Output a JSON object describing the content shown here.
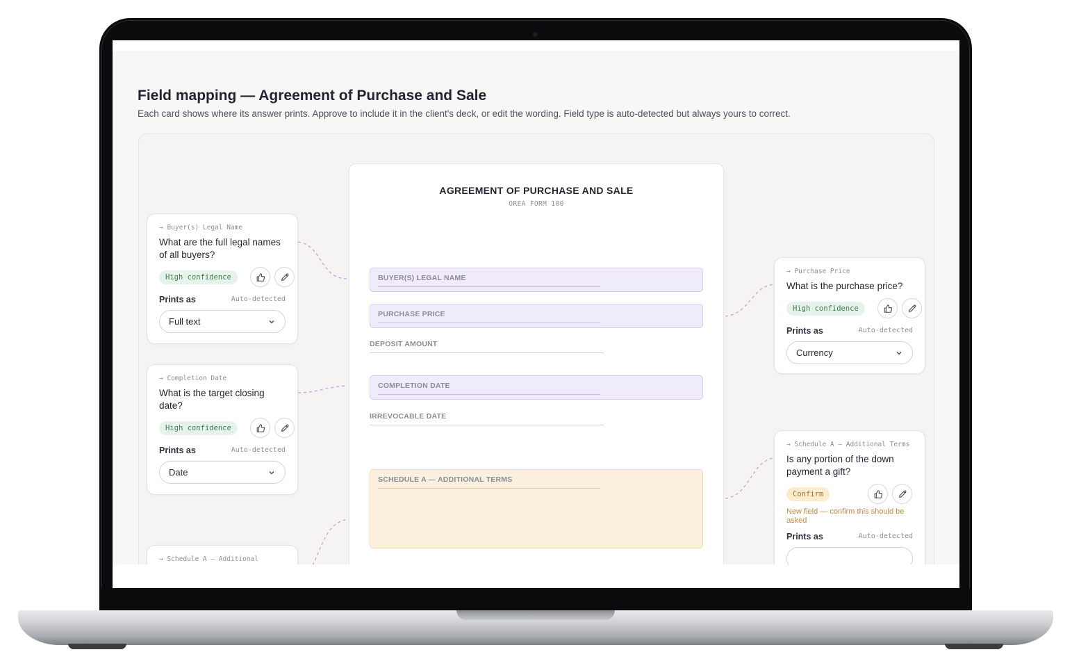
{
  "page": {
    "title": "Field mapping — Agreement of Purchase and Sale",
    "subtitle": "Each card shows where its answer prints. Approve to include it in the client's deck, or edit the wording. Field type is auto-detected but always yours to correct."
  },
  "document": {
    "title": "AGREEMENT OF PURCHASE AND SALE",
    "form": "OREA FORM 100",
    "fields": {
      "buyer_name": "BUYER(S) LEGAL NAME",
      "purchase_price": "PURCHASE PRICE",
      "deposit_amount": "DEPOSIT AMOUNT",
      "completion_date": "COMPLETION DATE",
      "irrevocable_date": "IRREVOCABLE DATE",
      "schedule_a": "SCHEDULE A — ADDITIONAL TERMS"
    }
  },
  "cards": {
    "buyer": {
      "tag": "→ Buyer(s) Legal Name",
      "question": "What are the full legal names of all buyers?",
      "badge": "High confidence",
      "prints_label": "Prints as",
      "auto": "Auto-detected",
      "type": "Full text"
    },
    "completion": {
      "tag": "→ Completion Date",
      "question": "What is the target closing date?",
      "badge": "High confidence",
      "prints_label": "Prints as",
      "auto": "Auto-detected",
      "type": "Date"
    },
    "schedule_left": {
      "tag": "→ Schedule A — Additional"
    },
    "price": {
      "tag": "→ Purchase Price",
      "question": "What is the purchase price?",
      "badge": "High confidence",
      "prints_label": "Prints as",
      "auto": "Auto-detected",
      "type": "Currency"
    },
    "schedule": {
      "tag": "→ Schedule A — Additional Terms",
      "question": "Is any portion of the down payment a gift?",
      "badge": "Confirm",
      "warning": "New field — confirm this should be asked",
      "prints_label": "Prints as",
      "auto": "Auto-detected"
    }
  },
  "colors": {
    "mapped_field": "#f0ebfb",
    "new_field": "#fbf0dd",
    "high_badge": "#e6f3ea",
    "confirm_badge": "#fbeccc",
    "connector": "#b9a4e6"
  },
  "icons": {
    "approve": "thumbs-up-icon",
    "edit": "pencil-icon",
    "dropdown": "chevron-down-icon"
  }
}
